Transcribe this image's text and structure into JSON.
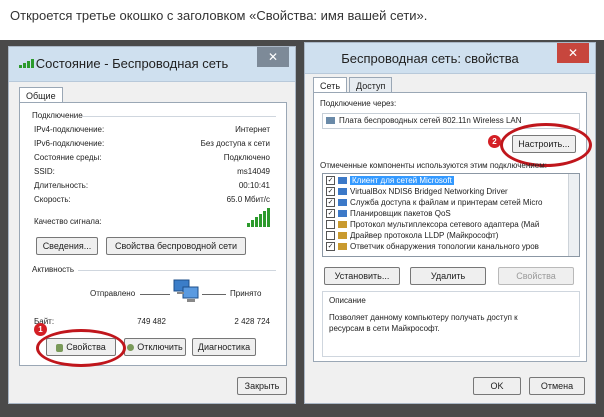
{
  "caption": "Откроется третье окошко с заголовком «Свойства: имя вашей сети».",
  "left_window": {
    "title": "Состояние - Беспроводная сеть",
    "tab": "Общие",
    "connection_header": "Подключение",
    "rows": [
      {
        "label": "IPv4-подключение:",
        "value": "Интернет"
      },
      {
        "label": "IPv6-подключение:",
        "value": "Без доступа к сети"
      },
      {
        "label": "Состояние среды:",
        "value": "Подключено"
      },
      {
        "label": "SSID:",
        "value": "ms14049"
      },
      {
        "label": "Длительность:",
        "value": "00:10:41"
      },
      {
        "label": "Скорость:",
        "value": "65.0 Мбит/с"
      }
    ],
    "signal_label": "Качество сигнала:",
    "details_btn": "Сведения...",
    "wireless_props_btn": "Свойства беспроводной сети",
    "activity_header": "Активность",
    "sent_label": "Отправлено",
    "received_label": "Принято",
    "bytes_label": "Байт:",
    "bytes_sent": "749 482",
    "bytes_received": "2 428 724",
    "props_btn": "Свойства",
    "disable_btn": "Отключить",
    "diagnose_btn": "Диагностика",
    "close_btn": "Закрыть",
    "marker": "1"
  },
  "right_window": {
    "title": "Беспроводная сеть: свойства",
    "tabs": [
      "Сеть",
      "Доступ"
    ],
    "connect_via_label": "Подключение через:",
    "adapter": "Плата беспроводных сетей 802.11n Wireless LAN",
    "configure_btn": "Настроить...",
    "components_label": "Отмеченные компоненты используются этим подключением:",
    "components": [
      {
        "checked": true,
        "text": "Клиент для сетей Microsoft"
      },
      {
        "checked": true,
        "text": "VirtualBox NDIS6 Bridged Networking Driver"
      },
      {
        "checked": true,
        "text": "Служба доступа к файлам и принтерам сетей Micro"
      },
      {
        "checked": true,
        "text": "Планировщик пакетов QoS"
      },
      {
        "checked": false,
        "text": "Протокол мультиплексора сетевого адаптера (Май"
      },
      {
        "checked": false,
        "text": "Драйвер протокола LLDP (Майкрософт)"
      },
      {
        "checked": true,
        "text": "Ответчик обнаружения топологии канального уров"
      }
    ],
    "install_btn": "Установить...",
    "remove_btn": "Удалить",
    "properties_btn": "Свойства",
    "description_header": "Описание",
    "description": "Позволяет данному компьютеру получать доступ к ресурсам в сети Майкрософт.",
    "ok_btn": "OK",
    "cancel_btn": "Отмена",
    "marker": "2"
  },
  "icons": {
    "close": "close-icon",
    "wifi": "wifi-signal-icon",
    "network": "network-computers-icon",
    "adapter": "network-adapter-icon"
  },
  "colors": {
    "titlebar": "#cfe0ef",
    "close_red": "#c7463d",
    "highlight": "#3399ff",
    "annotation": "#c0161c"
  }
}
